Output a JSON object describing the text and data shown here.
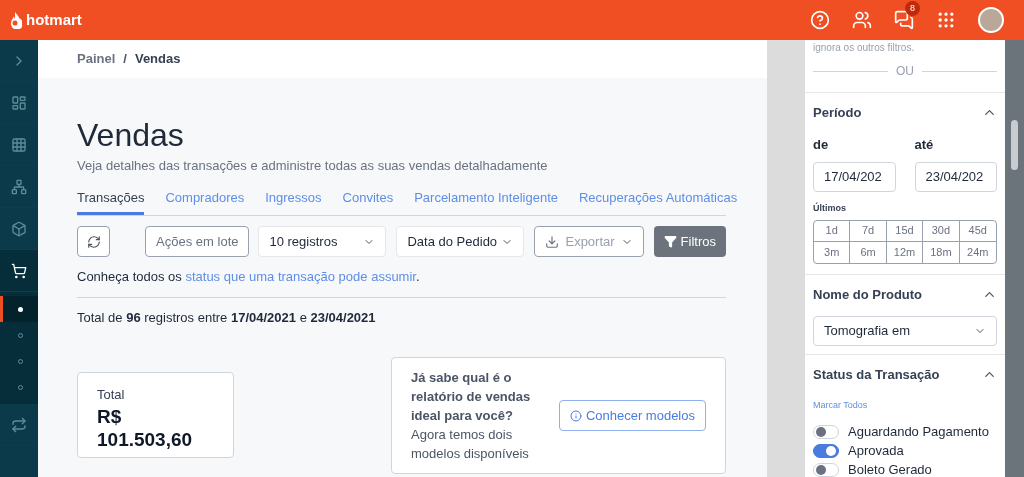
{
  "topbar": {
    "logo": "hotmart",
    "notifications_badge": "8"
  },
  "sidebar": {
    "sub_items": [
      {
        "selected": true
      },
      {
        "selected": false
      },
      {
        "selected": false
      },
      {
        "selected": false
      }
    ]
  },
  "breadcrumb": [
    "Painel",
    "/",
    "Vendas"
  ],
  "page": {
    "title": "Vendas",
    "subtitle": "Veja detalhes das transações e administre todas as suas vendas detalhadamente"
  },
  "tabs": [
    {
      "label": "Transações",
      "selected": true
    },
    {
      "label": "Compradores",
      "selected": false
    },
    {
      "label": "Ingressos",
      "selected": false
    },
    {
      "label": "Convites",
      "selected": false
    },
    {
      "label": "Parcelamento Inteligente",
      "selected": false
    },
    {
      "label": "Recuperações Automáticas",
      "selected": false
    }
  ],
  "toolbar": {
    "batch_actions": "Ações em lote",
    "page_size": "10 registros",
    "sort": "Data do Pedido",
    "export": "Exportar",
    "filters": "Filtros"
  },
  "status_note": {
    "text": "Conheça todos os",
    "link": "status que uma transação pode assumir",
    "end": "."
  },
  "summary": "Total de **96** registros entre **17/04/2021** e **23/04/2021**",
  "total_card": {
    "label": "Total",
    "value": "R$ 101.503,60"
  },
  "promo": {
    "text": "**Já sabe qual é o relatório de vendas ideal para você?** Agora temos dois modelos disponíveis",
    "button": "Conhecer modelos"
  },
  "filter_panel": {
    "hint": "ignora os outros filtros.",
    "divider": "OU",
    "period": {
      "title": "Período",
      "from_label": "de",
      "from_value": "17/04/202",
      "to_label": "até",
      "to_value": "23/04/202",
      "recent_label": "Últimos",
      "ranges": [
        {
          "label": "1d",
          "selected": false
        },
        {
          "label": "7d",
          "selected": false
        },
        {
          "label": "15d",
          "selected": false
        },
        {
          "label": "30d",
          "selected": false
        },
        {
          "label": "45d",
          "selected": false
        },
        {
          "label": "3m",
          "selected": false
        },
        {
          "label": "6m",
          "selected": false
        },
        {
          "label": "12m",
          "selected": false
        },
        {
          "label": "18m",
          "selected": false
        },
        {
          "label": "24m",
          "selected": false
        }
      ]
    },
    "product": {
      "title": "Nome do Produto",
      "value": "Tomografia em"
    },
    "status": {
      "title": "Status da Transação",
      "select_all": "Marcar Todos",
      "options": [
        {
          "label": "Aguardando Pagamento",
          "on": false
        },
        {
          "label": "Aprovada",
          "on": true
        },
        {
          "label": "Boleto Gerado",
          "on": false
        }
      ]
    }
  }
}
